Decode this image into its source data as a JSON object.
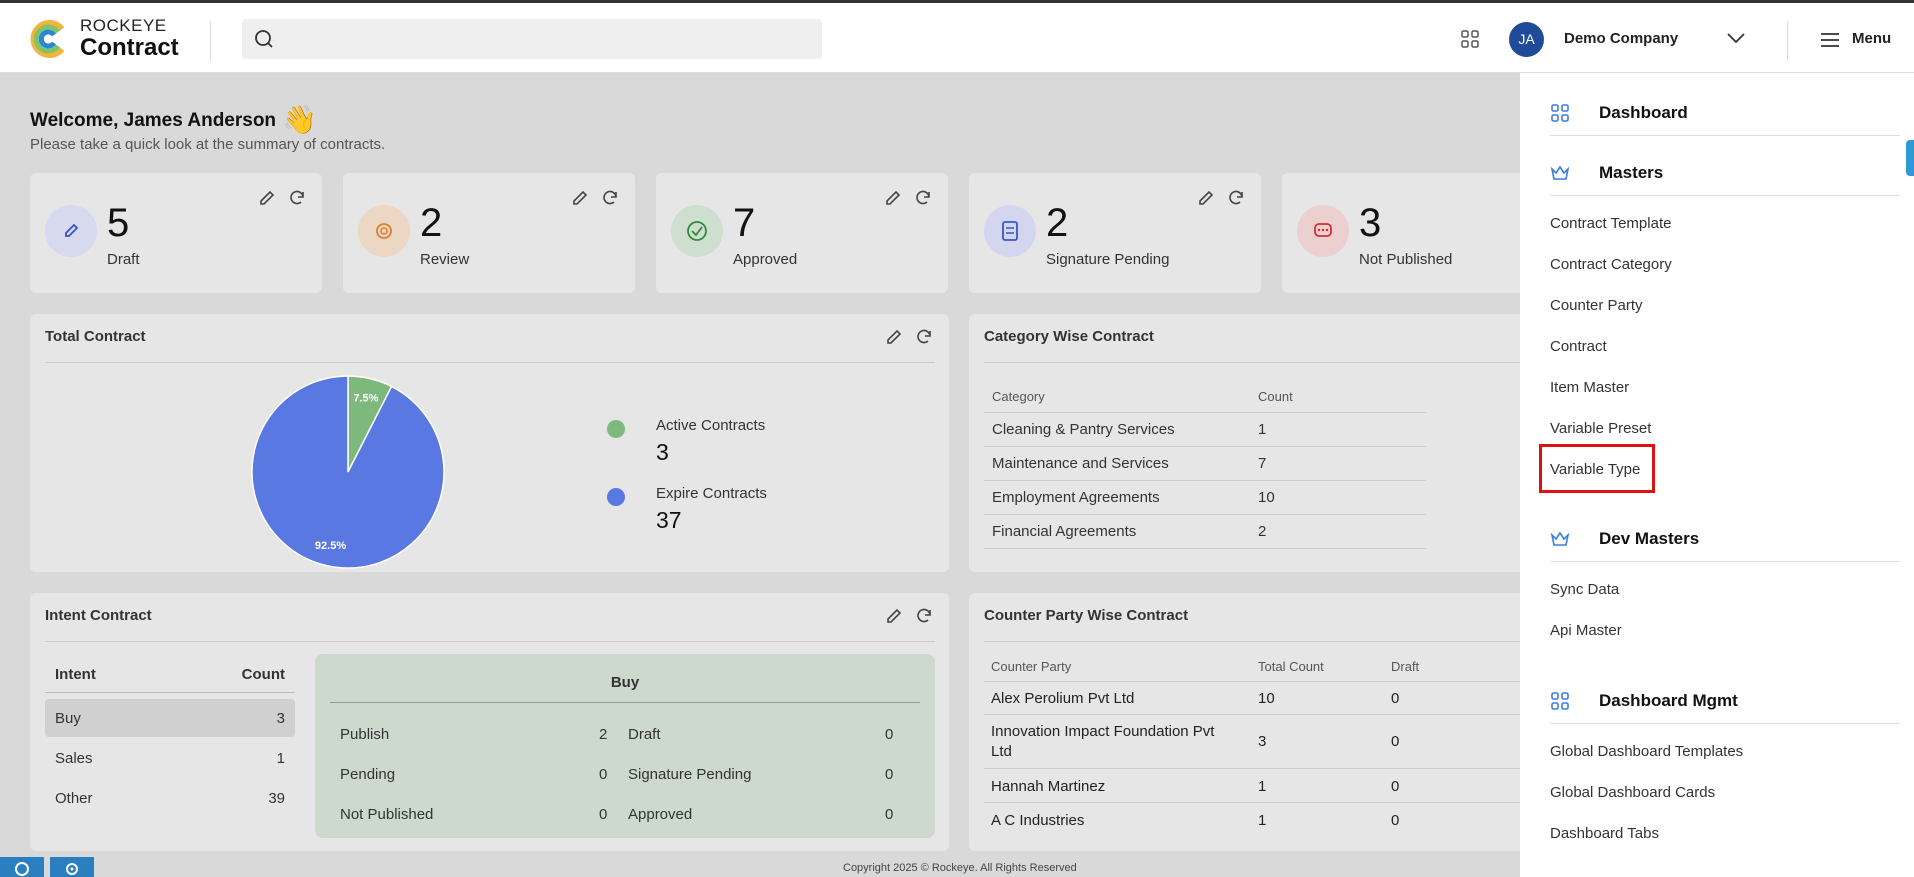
{
  "header": {
    "brand_top": "ROCKEYE",
    "brand_bottom": "Contract",
    "search_placeholder": "",
    "avatar_initials": "JA",
    "company": "Demo Company",
    "menu_label": "Menu"
  },
  "welcome": {
    "title": "Welcome, James Anderson",
    "wave": "👋",
    "subtitle": "Please take a quick look at the summary of contracts."
  },
  "stats": [
    {
      "value": "5",
      "label": "Draft",
      "color": "#d7d9ef",
      "icon_color": "#3b55c9"
    },
    {
      "value": "2",
      "label": "Review",
      "color": "#ecd7c4",
      "icon_color": "#e07b2a"
    },
    {
      "value": "7",
      "label": "Approved",
      "color": "#cfdfcf",
      "icon_color": "#2e8b3a"
    },
    {
      "value": "2",
      "label": "Signature Pending",
      "color": "#d3d6ee",
      "icon_color": "#3b55c9"
    },
    {
      "value": "3",
      "label": "Not Published",
      "color": "#ecd0d0",
      "icon_color": "#d13030"
    }
  ],
  "total_contract": {
    "title": "Total Contract",
    "legend": [
      {
        "label": "Active Contracts",
        "value": "3",
        "color": "#7db87d"
      },
      {
        "label": "Expire Contracts",
        "value": "37",
        "color": "#5a78e2"
      }
    ]
  },
  "chart_data": {
    "type": "pie",
    "labels": [
      "Active Contracts",
      "Expire Contracts"
    ],
    "values": [
      3,
      37
    ],
    "slice_labels": [
      "7.5%",
      "92.5%"
    ],
    "colors": [
      "#7db87d",
      "#5a78e2"
    ]
  },
  "category": {
    "title": "Category Wise Contract",
    "headers": [
      "Category",
      "Count"
    ],
    "rows": [
      [
        "Cleaning & Pantry Services",
        "1"
      ],
      [
        "Maintenance and Services",
        "7"
      ],
      [
        "Employment Agreements",
        "10"
      ],
      [
        "Financial Agreements",
        "2"
      ]
    ]
  },
  "intent": {
    "title": "Intent Contract",
    "headers": [
      "Intent",
      "Count"
    ],
    "rows": [
      [
        "Buy",
        "3"
      ],
      [
        "Sales",
        "1"
      ],
      [
        "Other",
        "39"
      ]
    ],
    "detail_title": "Buy",
    "detail": [
      [
        "Publish",
        "2",
        "Draft",
        "0"
      ],
      [
        "Pending",
        "0",
        "Signature Pending",
        "0"
      ],
      [
        "Not Published",
        "0",
        "Approved",
        "0"
      ]
    ]
  },
  "counter_party": {
    "title": "Counter Party Wise Contract",
    "headers": [
      "Counter Party",
      "Total Count",
      "Draft"
    ],
    "rows": [
      [
        "Alex Perolium Pvt Ltd",
        "10",
        "0"
      ],
      [
        "Innovation Impact Foundation Pvt",
        "3",
        "0"
      ],
      [
        "Hannah Martinez",
        "1",
        "0"
      ],
      [
        "A C Industries",
        "1",
        "0"
      ]
    ],
    "row2_cont": "Ltd"
  },
  "footer": {
    "copyright": "Copyright 2025 © Rockeye. All Rights Reserved"
  },
  "sidemenu": {
    "dashboard": "Dashboard",
    "masters": "Masters",
    "masters_items": [
      "Contract Template",
      "Contract Category",
      "Counter Party",
      "Contract",
      "Item Master",
      "Variable Preset",
      "Variable Type"
    ],
    "dev_masters": "Dev Masters",
    "dev_items": [
      "Sync Data",
      "Api Master"
    ],
    "dashboard_mgmt": "Dashboard Mgmt",
    "mgmt_items": [
      "Global Dashboard Templates",
      "Global Dashboard Cards",
      "Dashboard Tabs"
    ]
  }
}
